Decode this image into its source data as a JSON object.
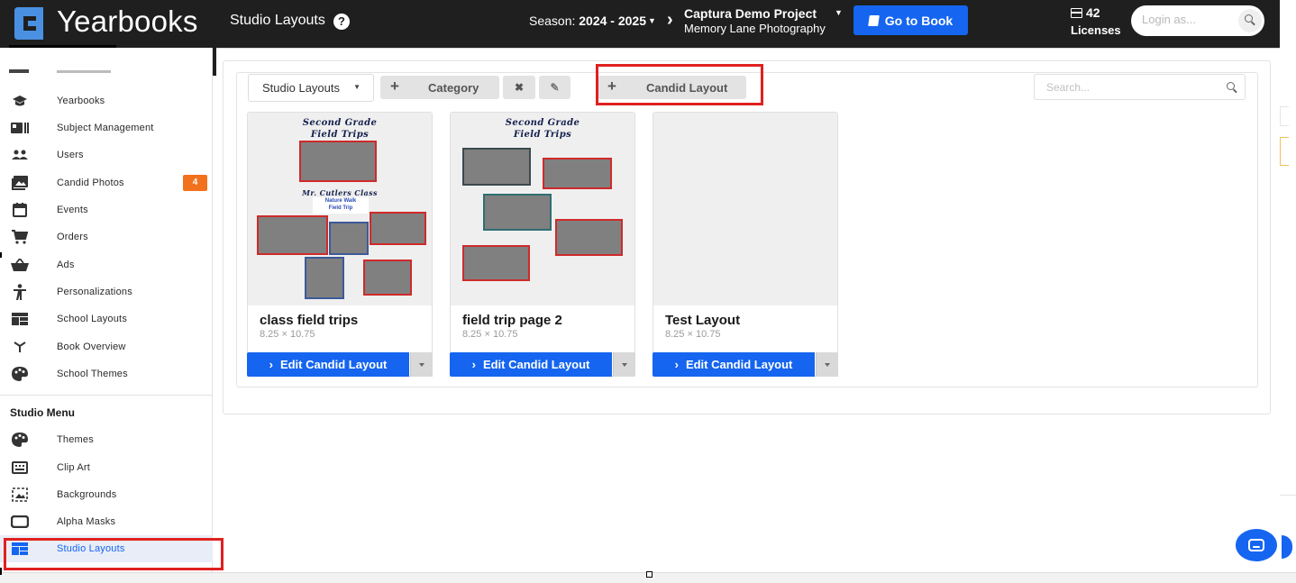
{
  "brand": {
    "name": "Yearbooks"
  },
  "header": {
    "page_title": "Studio Layouts",
    "help_glyph": "?",
    "season_label": "Season:",
    "season_value": "2024 - 2025",
    "project_name": "Captura Demo Project",
    "project_sub": "Memory Lane Photography",
    "go_to_book": "Go to Book",
    "licenses_count": "42",
    "licenses_label": "Licenses",
    "login_placeholder": "Login as..."
  },
  "sidebar": {
    "items": [
      {
        "label": "Yearbooks",
        "icon": "graduation-cap-icon"
      },
      {
        "label": "Subject Management",
        "icon": "id-card-icon"
      },
      {
        "label": "Users",
        "icon": "users-icon"
      },
      {
        "label": "Candid Photos",
        "icon": "photos-icon",
        "badge": "4"
      },
      {
        "label": "Events",
        "icon": "calendar-icon"
      },
      {
        "label": "Orders",
        "icon": "cart-icon"
      },
      {
        "label": "Ads",
        "icon": "basket-icon"
      },
      {
        "label": "Personalizations",
        "icon": "person-icon"
      },
      {
        "label": "School Layouts",
        "icon": "layout-icon"
      },
      {
        "label": "Book Overview",
        "icon": "sitemap-icon"
      },
      {
        "label": "School Themes",
        "icon": "palette-icon"
      }
    ],
    "studio_heading": "Studio Menu",
    "studio_items": [
      {
        "label": "Themes",
        "icon": "palette-icon"
      },
      {
        "label": "Clip Art",
        "icon": "keyboard-icon"
      },
      {
        "label": "Backgrounds",
        "icon": "image-frame-icon"
      },
      {
        "label": "Alpha Masks",
        "icon": "rounded-rect-icon"
      },
      {
        "label": "Studio Layouts",
        "icon": "layout-icon",
        "active": true
      }
    ]
  },
  "toolbar": {
    "select_value": "Studio Layouts",
    "category_label": "Category",
    "delete_glyph": "✖",
    "edit_glyph": "✎",
    "candid_layout_label": "Candid Layout",
    "search_placeholder": "Search..."
  },
  "cards": [
    {
      "name": "class field trips",
      "size": "8.25 × 10.75",
      "button": "Edit Candid Layout",
      "title_line1": "Second Grade",
      "title_line2": "Field Trips",
      "subtitle": "Mr. Cutlers Class",
      "caption_line1": "Nature Walk",
      "caption_line2": "Field Trip"
    },
    {
      "name": "field trip page 2",
      "size": "8.25 × 10.75",
      "button": "Edit Candid Layout",
      "title_line1": "Second Grade",
      "title_line2": "Field Trips"
    },
    {
      "name": "Test Layout",
      "size": "8.25 × 10.75",
      "button": "Edit Candid Layout"
    }
  ],
  "colors": {
    "primary": "#1565f0",
    "topbar": "#1f1f1f",
    "badge": "#f2711c",
    "highlight": "#e02020"
  }
}
